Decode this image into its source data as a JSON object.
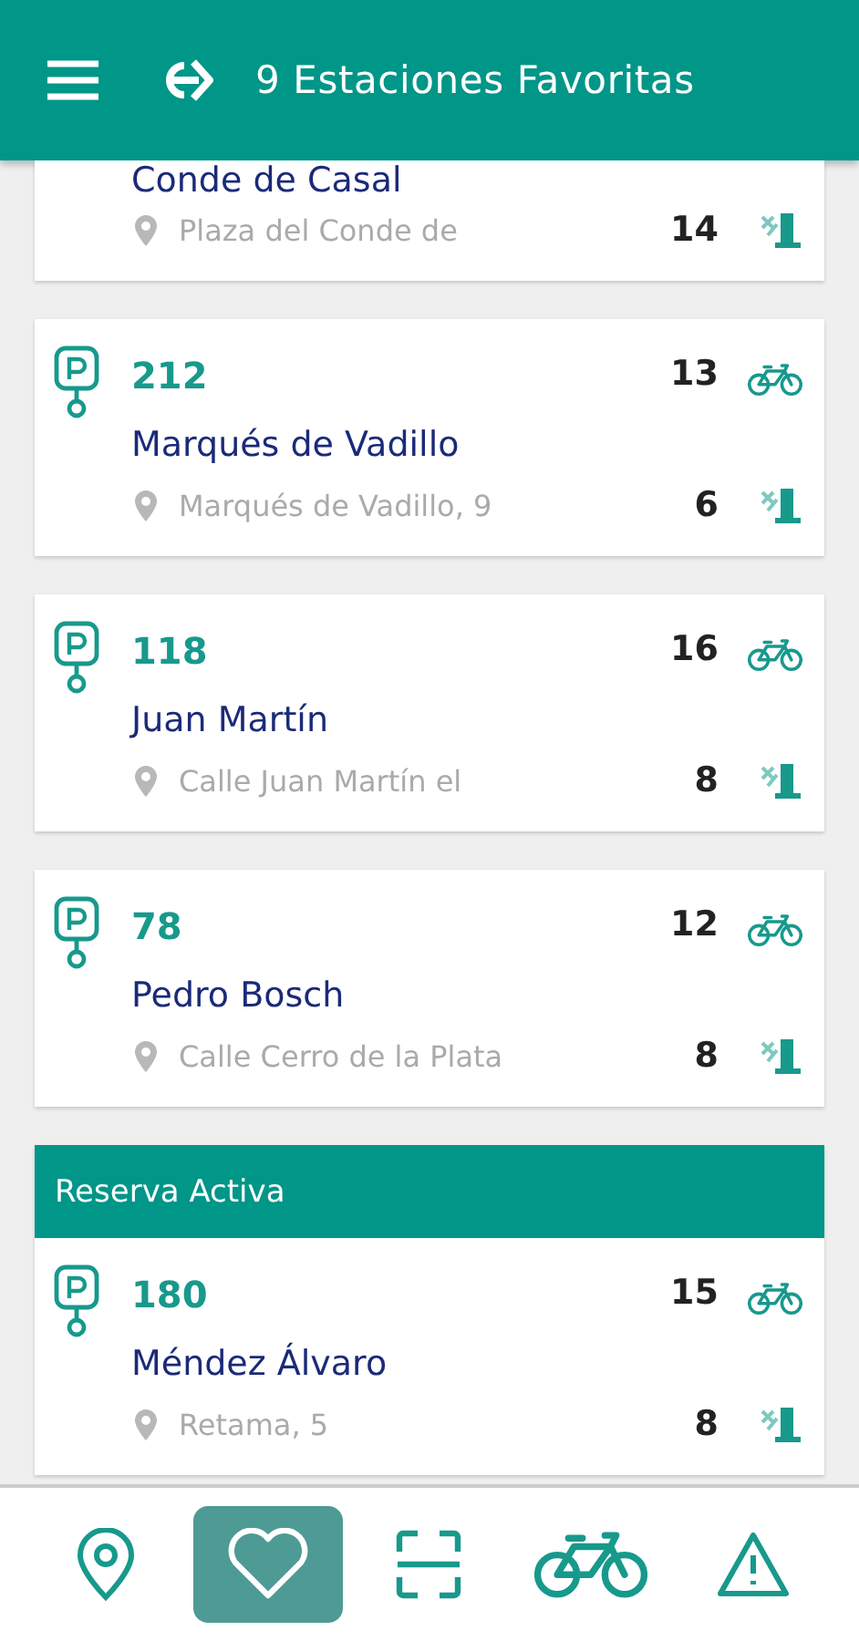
{
  "header": {
    "title": "9 Estaciones Favoritas"
  },
  "stations": [
    {
      "kind": "partial",
      "name": "Conde de Casal",
      "address": "Plaza del Conde de",
      "docks": "14"
    },
    {
      "kind": "full",
      "number": "212",
      "name": "Marqués de Vadillo",
      "address": "Marqués de Vadillo, 9",
      "bikes": "13",
      "docks": "6"
    },
    {
      "kind": "full",
      "number": "118",
      "name": "Juan Martín",
      "address": "Calle Juan Martín el",
      "bikes": "16",
      "docks": "8"
    },
    {
      "kind": "full",
      "number": "78",
      "name": "Pedro Bosch",
      "address": "Calle Cerro de la Plata",
      "bikes": "12",
      "docks": "8"
    }
  ],
  "reservation": {
    "label": "Reserva Activa",
    "station": {
      "kind": "full",
      "number": "180",
      "name": "Méndez Álvaro",
      "address": "Retama, 5",
      "bikes": "15",
      "docks": "8"
    }
  },
  "nav": [
    {
      "kind": "map",
      "selected": false
    },
    {
      "kind": "favorites",
      "selected": true
    },
    {
      "kind": "scan",
      "selected": false
    },
    {
      "kind": "bike",
      "selected": false
    },
    {
      "kind": "alert",
      "selected": false
    }
  ]
}
